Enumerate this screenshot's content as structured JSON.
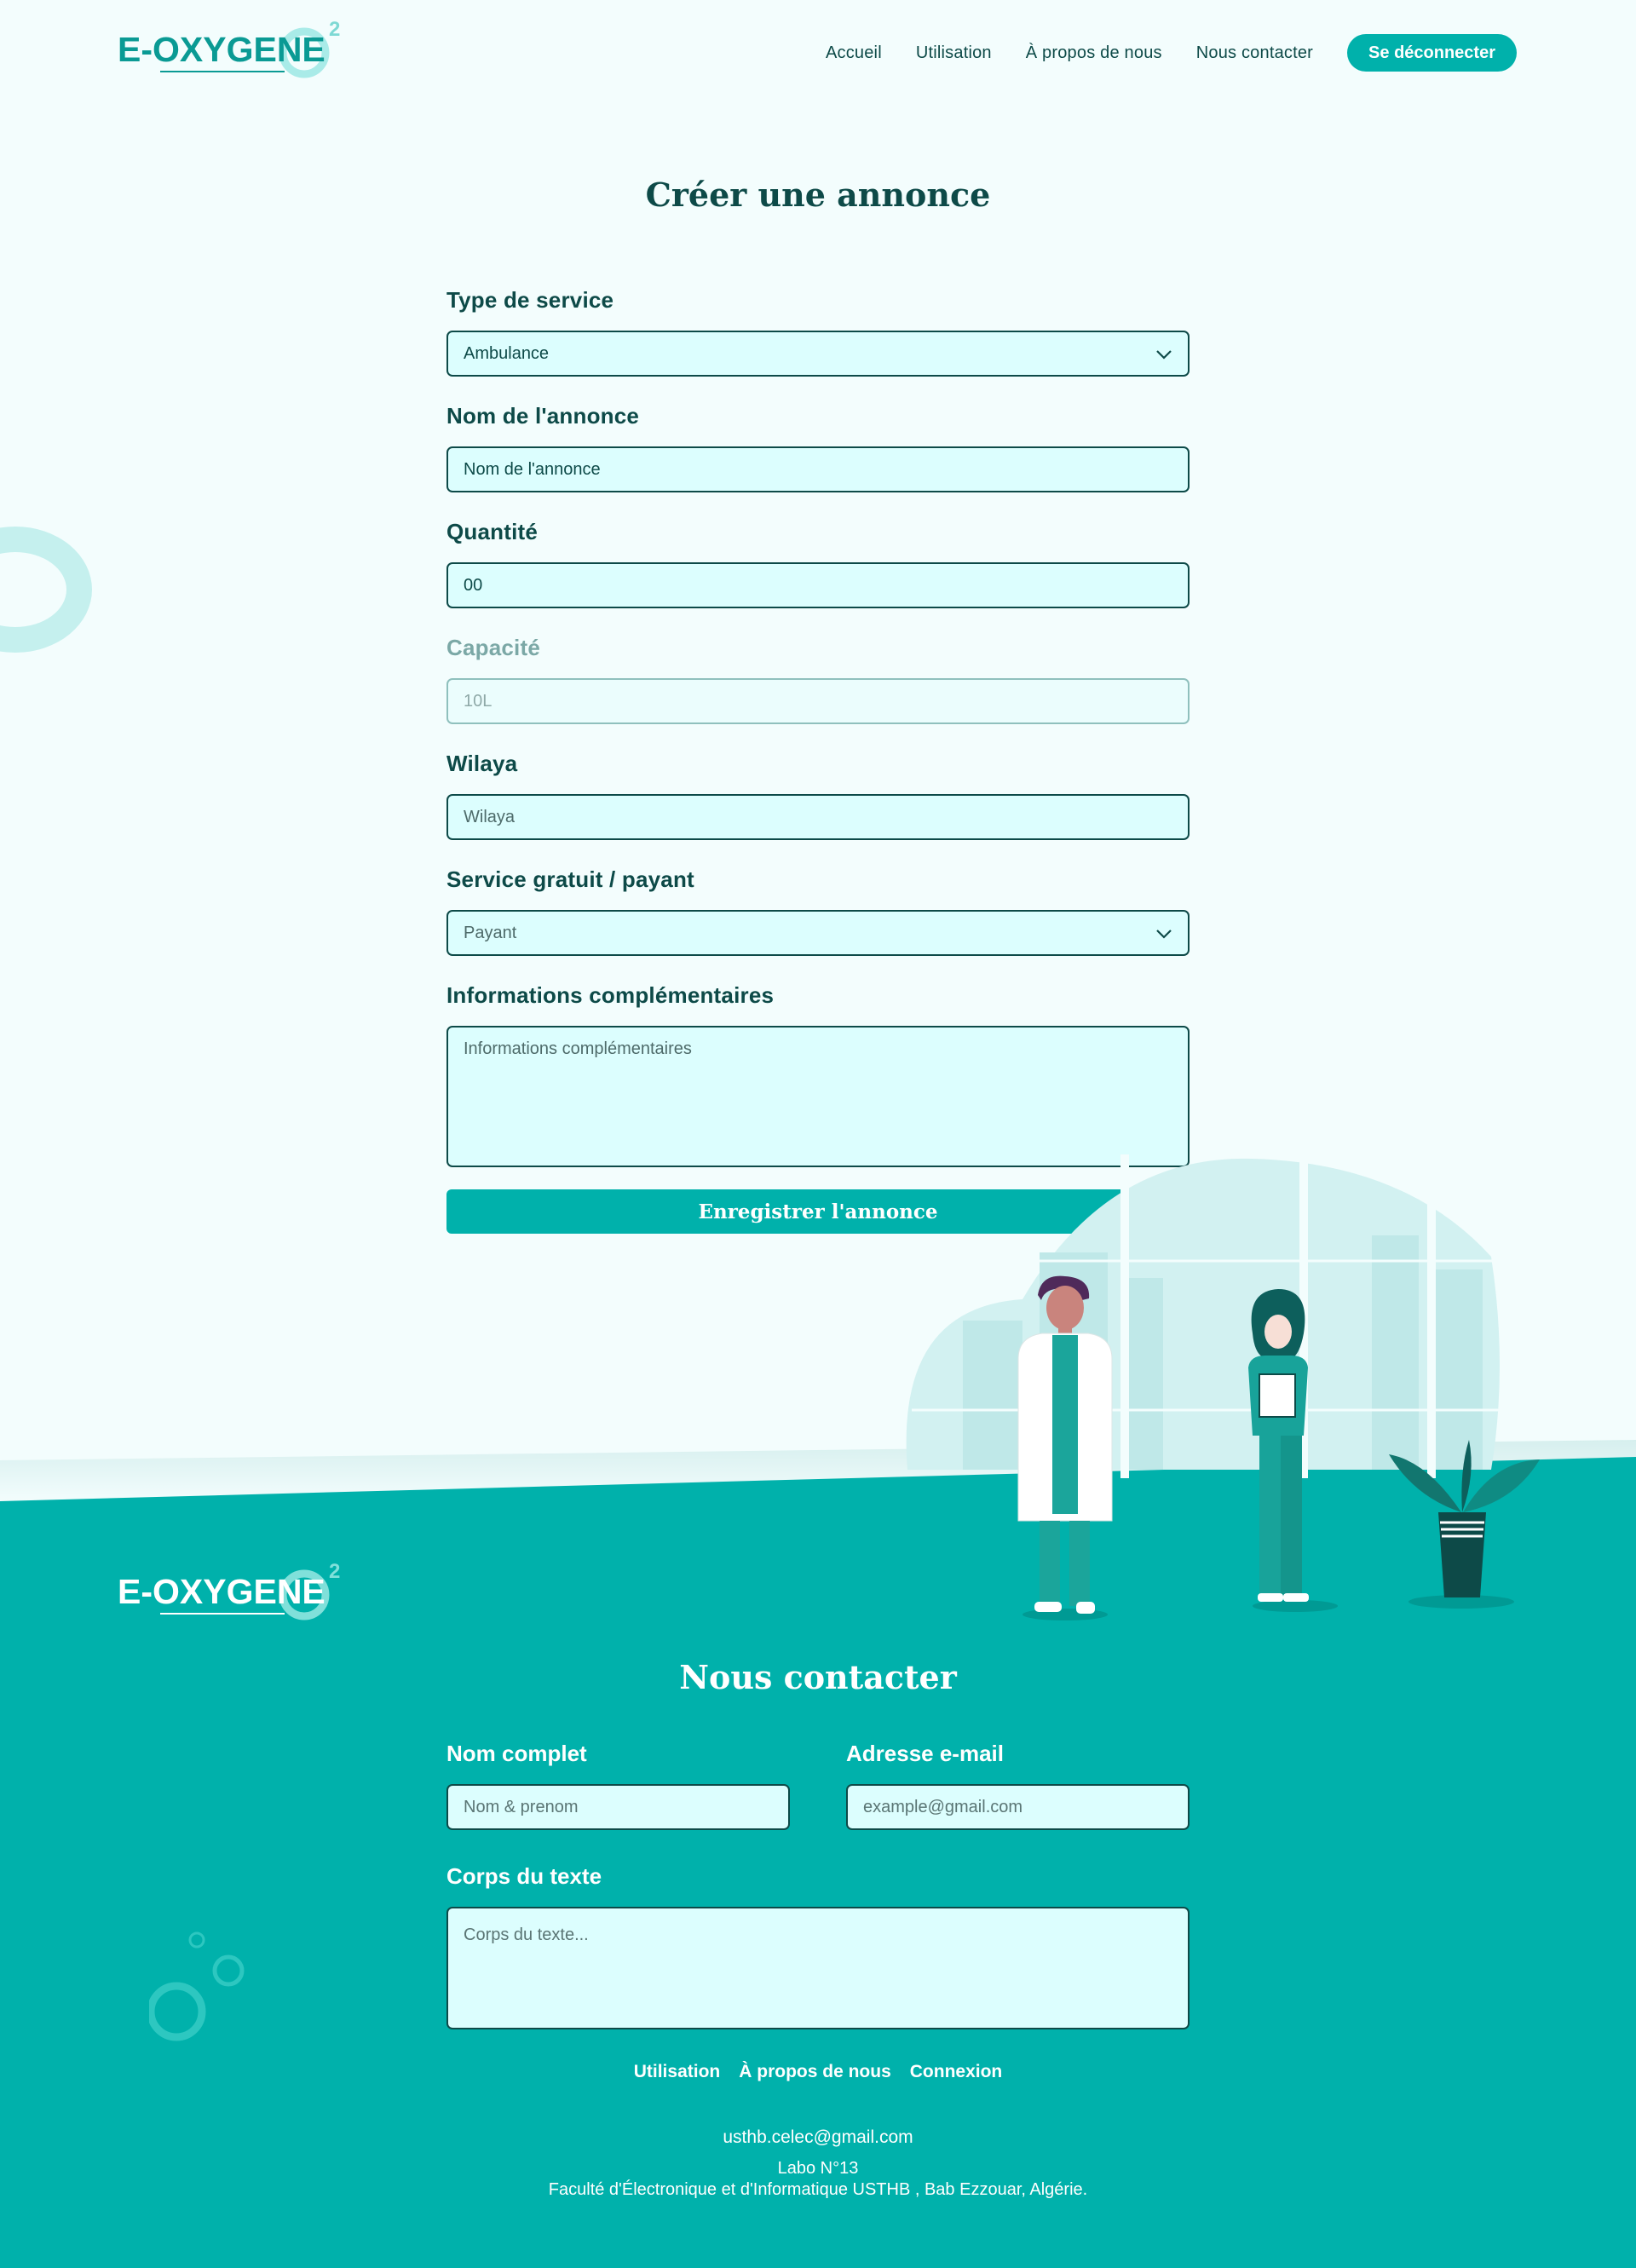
{
  "brand": {
    "logo_text": "E-OXYGENE",
    "logo_sup": "2"
  },
  "nav": {
    "items": [
      "Accueil",
      "Utilisation",
      "À propos de nous",
      "Nous contacter"
    ],
    "logout": "Se déconnecter"
  },
  "page": {
    "title": "Créer une annonce"
  },
  "form": {
    "service_type": {
      "label": "Type de service",
      "value": "Ambulance"
    },
    "name": {
      "label": "Nom de l'annonce",
      "placeholder": "Nom de l'annonce"
    },
    "quantity": {
      "label": "Quantité",
      "value": "00"
    },
    "capacity": {
      "label": "Capacité",
      "value": "10L",
      "disabled": true
    },
    "wilaya": {
      "label": "Wilaya",
      "placeholder": "Wilaya"
    },
    "payment": {
      "label": "Service gratuit / payant",
      "value": "Payant"
    },
    "info": {
      "label": "Informations complémentaires",
      "placeholder": "Informations complémentaires"
    },
    "submit": "Enregistrer l'annonce"
  },
  "contact": {
    "title": "Nous contacter",
    "fullname": {
      "label": "Nom complet",
      "placeholder": "Nom & prenom"
    },
    "email": {
      "label": "Adresse e-mail",
      "placeholder": "example@gmail.com"
    },
    "body": {
      "label": "Corps du texte",
      "placeholder": "Corps du texte..."
    }
  },
  "footer": {
    "links": [
      "Utilisation",
      "À propos de nous",
      "Connexion"
    ],
    "email": "usthb.celec@gmail.com",
    "address_line1": "Labo N°13",
    "address_line2": "Faculté d'Électronique et d'Informatique USTHB , Bab Ezzouar, Algérie."
  },
  "colors": {
    "primary": "#00b1ab",
    "dark": "#0d4a48",
    "input_bg": "#dcfefe",
    "page_bg": "#f3fdfd"
  },
  "icons": [
    "chevron-down-icon",
    "logo-o2-icon",
    "decorative-ring",
    "doctors-illustration",
    "bubbles-decoration"
  ]
}
